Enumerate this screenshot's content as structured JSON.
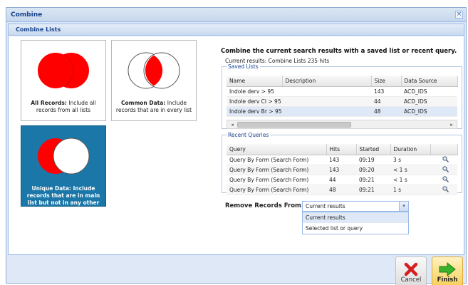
{
  "window": {
    "title": "Combine",
    "close_glyph": "×"
  },
  "panel": {
    "title": "Combine Lists"
  },
  "options": [
    {
      "bold": "All Records:",
      "text": " Include all records from all lists",
      "icon": "venn-union-icon"
    },
    {
      "bold": "Common Data:",
      "text": " Include records that are in every list",
      "icon": "venn-intersection-icon"
    },
    {
      "bold": "Unique Data:",
      "text": " Include records that are in main list but not in any other",
      "icon": "venn-difference-icon"
    }
  ],
  "heading": "Combine the current search results with a saved list or recent query.",
  "current_results": "Current results: Combine Lists 235 hits",
  "saved_lists": {
    "legend": "Saved Lists",
    "columns": [
      "Name",
      "Description",
      "Size",
      "Data Source"
    ],
    "rows": [
      [
        "Indole derv > 95",
        "",
        "143",
        "ACD_IDS"
      ],
      [
        "Indole derv Cl > 95",
        "",
        "44",
        "ACD_IDS"
      ],
      [
        "Indole derv Br > 95",
        "",
        "48",
        "ACD_IDS"
      ]
    ],
    "scroll_left": "◂",
    "scroll_right": "▸"
  },
  "recent_queries": {
    "legend": "Recent Queries",
    "columns": [
      "Query",
      "Hits",
      "Started",
      "Duration"
    ],
    "rows": [
      [
        "Query By Form (Search Form)",
        "143",
        "09:19",
        "3 s"
      ],
      [
        "Query By Form (Search Form)",
        "143",
        "09:20",
        "< 1 s"
      ],
      [
        "Query By Form (Search Form)",
        "44",
        "09:21",
        "< 1 s"
      ],
      [
        "Query By Form (Search Form)",
        "48",
        "09:21",
        "1 s"
      ]
    ]
  },
  "remove_from": {
    "label": "Remove Records From:",
    "value": "Current results",
    "options": [
      "Current results",
      "Selected list or query"
    ],
    "trigger_glyph": "▾"
  },
  "buttons": {
    "cancel": "Cancel",
    "finish": "Finish"
  },
  "colors": {
    "accent": "#1b77a8",
    "venn_red": "#ff0000",
    "finish_bg": "#f8cf55"
  }
}
